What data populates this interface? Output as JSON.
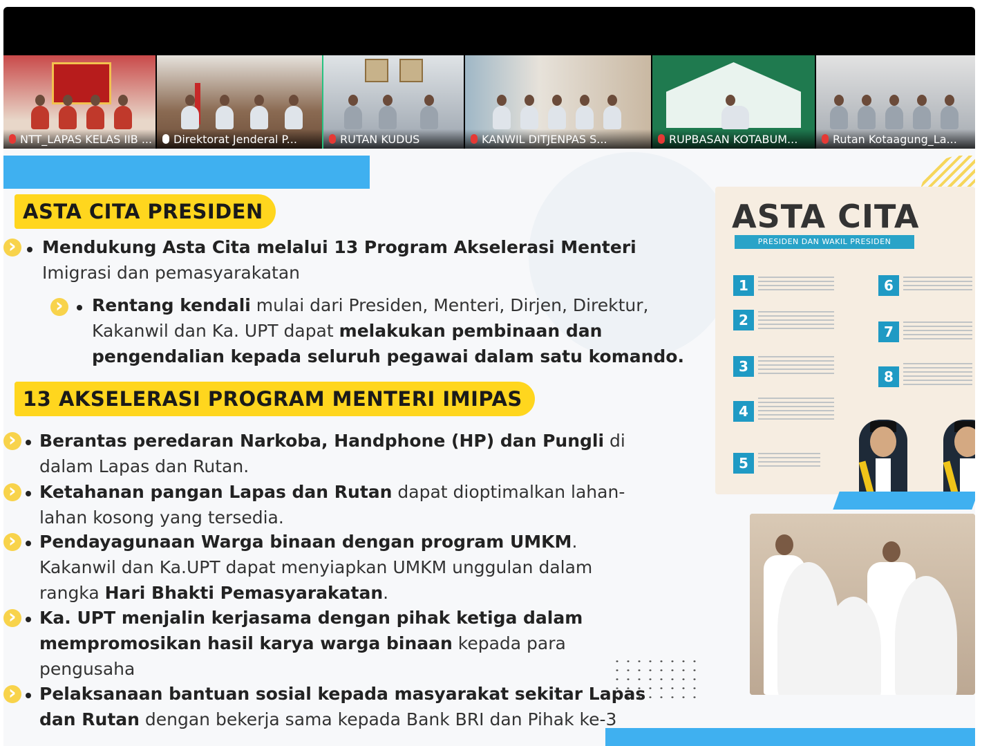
{
  "participants": [
    {
      "name": "NTT_LAPAS KELAS IIB ...",
      "mic": "muted"
    },
    {
      "name": "Direktorat Jenderal P...",
      "mic": "active"
    },
    {
      "name": "RUTAN KUDUS",
      "mic": "muted"
    },
    {
      "name": "KANWIL DITJENPAS S...",
      "mic": "muted"
    },
    {
      "name": "RUPBASAN KOTABUM...",
      "mic": "muted"
    },
    {
      "name": "Rutan Kotaagung_La...",
      "mic": "muted"
    }
  ],
  "slide": {
    "section1_title": "ASTA CITA PRESIDEN",
    "s1_item1_bold": "Mendukung Asta Cita melalui 13 Program Akselerasi Menteri",
    "s1_item1_rest": "Imigrasi dan pemasyarakatan",
    "s1_sub1_bold": "Rentang kendali",
    "s1_sub1_line1_rest": " mulai dari Presiden, Menteri, Dirjen, Direktur,",
    "s1_sub1_line2_plain": "Kakanwil dan Ka. UPT dapat ",
    "s1_sub1_line2_bold": "melakukan pembinaan dan",
    "s1_sub1_line3_bold": "pengendalian kepada seluruh pegawai dalam satu komando.",
    "section2_title": "13 AKSELERASI PROGRAM MENTERI IMIPAS",
    "p1_bold": "Berantas peredaran Narkoba, Handphone (HP) dan Pungli",
    "p1_rest1": " di",
    "p1_rest2": "dalam Lapas dan Rutan.",
    "p2_bold": "Ketahanan pangan Lapas dan Rutan",
    "p2_rest1": "  dapat dioptimalkan lahan-",
    "p2_rest2": "lahan kosong yang tersedia.",
    "p3_bold": "Pendayagunaan Warga binaan dengan program UMKM",
    "p3_rest1": ".",
    "p3_rest2": "Kakanwil dan Ka.UPT dapat menyiapkan UMKM unggulan dalam",
    "p3_rest3_plain": "rangka ",
    "p3_rest3_bold": "Hari Bhakti Pemasyarakatan",
    "p3_rest3_end": ".",
    "p4_bold1": "Ka. UPT menjalin kerjasama dengan pihak ketiga dalam",
    "p4_bold2": "mempromosikan hasil karya warga binaan",
    "p4_rest2": " kepada para",
    "p4_rest3": "pengusaha",
    "p5_bold1": "Pelaksanaan bantuan sosial kepada masyarakat sekitar Lapas",
    "p5_bold2": "dan Rutan",
    "p5_rest2": " dengan bekerja sama kepada Bank BRI dan Pihak ke-3"
  },
  "panel": {
    "title": "ASTA CITA",
    "subtitle": "PRESIDEN DAN WAKIL PRESIDEN",
    "numbers": [
      "1",
      "2",
      "3",
      "4",
      "5",
      "6",
      "7",
      "8"
    ]
  },
  "colors": {
    "accent_yellow": "#ffd61e",
    "accent_blue": "#3fb0f0",
    "active_tile": "#26c281"
  }
}
